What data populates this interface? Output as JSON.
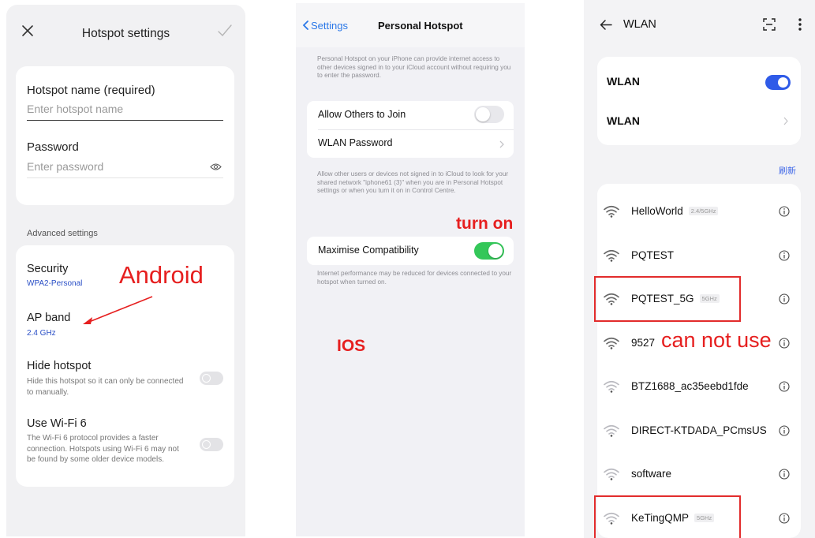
{
  "android": {
    "title": "Hotspot settings",
    "hotspot_name_label": "Hotspot name (required)",
    "hotspot_name_placeholder": "Enter hotspot name",
    "password_label": "Password",
    "password_placeholder": "Enter password",
    "advanced_label": "Advanced settings",
    "security_title": "Security",
    "security_value": "WPA2-Personal",
    "ap_band_title": "AP band",
    "ap_band_value": "2.4 GHz",
    "hide_title": "Hide hotspot",
    "hide_desc": "Hide this hotspot so it can only be connected to manually.",
    "hide_enabled": false,
    "wifi6_title": "Use Wi-Fi 6",
    "wifi6_desc": "The Wi-Fi 6 protocol provides a faster connection. Hotspots using Wi-Fi 6 may not be found by some older device models.",
    "wifi6_enabled": false,
    "annotation": "Android",
    "accent_color": "#2a4fc6"
  },
  "ios": {
    "back_label": "Settings",
    "title": "Personal Hotspot",
    "intro_note": "Personal Hotspot on your iPhone can provide internet access to other devices signed in to your iCloud account without requiring you to enter the password.",
    "allow_label": "Allow Others to Join",
    "allow_enabled": false,
    "password_label": "WLAN Password",
    "mid_note": "Allow other users or devices not signed in to iCloud to look for your shared network \"iphone61 (3)\" when you are in Personal Hotspot settings or when you turn it on in Control Centre.",
    "compat_label": "Maximise Compatibility",
    "compat_enabled": true,
    "compat_note": "Internet performance may be reduced for devices connected to your hotspot when turned on.",
    "annotation_turn_on": "turn on",
    "annotation_ios": "IOS",
    "toggle_on_color": "#34c759",
    "link_color": "#2b78e8"
  },
  "wlan": {
    "title": "WLAN",
    "toggle_label": "WLAN",
    "toggle_enabled": true,
    "second_row_label": "WLAN",
    "refresh_label": "刷新",
    "networks": [
      {
        "ssid": "HelloWorld",
        "badge": "2.4/5GHz",
        "highlighted": false
      },
      {
        "ssid": "PQTEST",
        "badge": "",
        "highlighted": false
      },
      {
        "ssid": "PQTEST_5G",
        "badge": "5GHz",
        "highlighted": true
      },
      {
        "ssid": "9527",
        "badge": "",
        "highlighted": false
      },
      {
        "ssid": "BTZ1688_ac35eebd1fde",
        "badge": "",
        "highlighted": false
      },
      {
        "ssid": "DIRECT-KTDADA_PCmsUS",
        "badge": "",
        "highlighted": false
      },
      {
        "ssid": "software",
        "badge": "",
        "highlighted": false
      },
      {
        "ssid": "KeTingQMP",
        "badge": "5GHz",
        "highlighted": true
      }
    ],
    "annotation": "can not use",
    "accent_color": "#2f5be8",
    "highlight_color": "#e22c2c"
  }
}
